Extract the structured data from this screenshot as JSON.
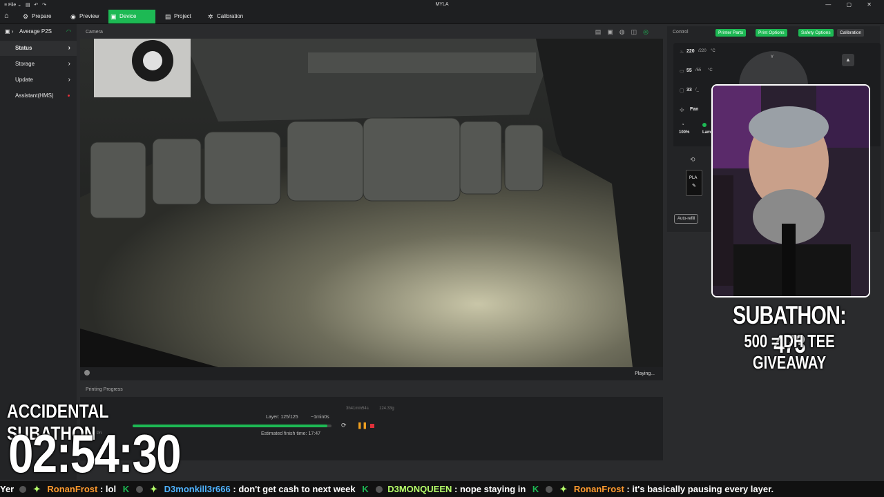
{
  "window": {
    "title": "MYLA",
    "file_menu": "File",
    "controls": "— ▢ ✕"
  },
  "tabs": [
    {
      "label": "Prepare",
      "icon": "prepare-icon"
    },
    {
      "label": "Preview",
      "icon": "preview-icon"
    },
    {
      "label": "Device",
      "icon": "device-icon",
      "active": true
    },
    {
      "label": "Project",
      "icon": "project-icon"
    },
    {
      "label": "Calibration",
      "icon": "calibration-icon"
    }
  ],
  "sidebar": {
    "printer": "Average P2S",
    "items": [
      {
        "label": "Status",
        "active": true
      },
      {
        "label": "Storage"
      },
      {
        "label": "Update"
      },
      {
        "label": "Assistant(HMS)",
        "alert": true
      }
    ]
  },
  "camera": {
    "title": "Camera",
    "status": "Playing..."
  },
  "progress": {
    "title": "Printing Progress",
    "layer": "Layer: 125/125",
    "remaining": "~1min0s",
    "duration": "3h41min54s",
    "weight": "124.33g",
    "finish": "Estimated finish time: 17:47",
    "percent": 0.98,
    "prefix": "Pri"
  },
  "control": {
    "title": "Control",
    "chips": [
      "Printer Parts",
      "Print Options",
      "Safety Options",
      "Calibration"
    ],
    "nozzle_temp": "220",
    "nozzle_target": "/220",
    "bed_temp": "55",
    "bed_target": "/55",
    "chamber_temp": "33",
    "chamber_target": "/_",
    "unit": "°C",
    "fan_label": "Fan",
    "fan_percent": "100%",
    "lamp_label": "Lam",
    "filament": "PLA",
    "autorefill": "Auto-refill",
    "y_label": "Y"
  },
  "overlay": {
    "subathon_count": "SUBATHON: 473",
    "giveaway": "500 = DH TEE GIVEAWAY",
    "accidental": "ACCIDENTAL SUBATHON",
    "timer": "02:54:30"
  },
  "ticker": [
    {
      "name": "Yer",
      "msg": ""
    },
    {
      "name": "RonanFrost",
      "msg": "lol",
      "color": "orange"
    },
    {
      "name": "D3monkill3r666",
      "msg": "don't get cash to next week",
      "color": "blue"
    },
    {
      "name": "D3MONQUEEN",
      "msg": "nope staying in",
      "color": "green"
    },
    {
      "name": "RonanFrost",
      "msg": "it's basically pausing every layer.",
      "color": "orange"
    }
  ],
  "colors": {
    "accent": "#1db954",
    "danger": "#e0303a",
    "pause": "#f0a020"
  }
}
